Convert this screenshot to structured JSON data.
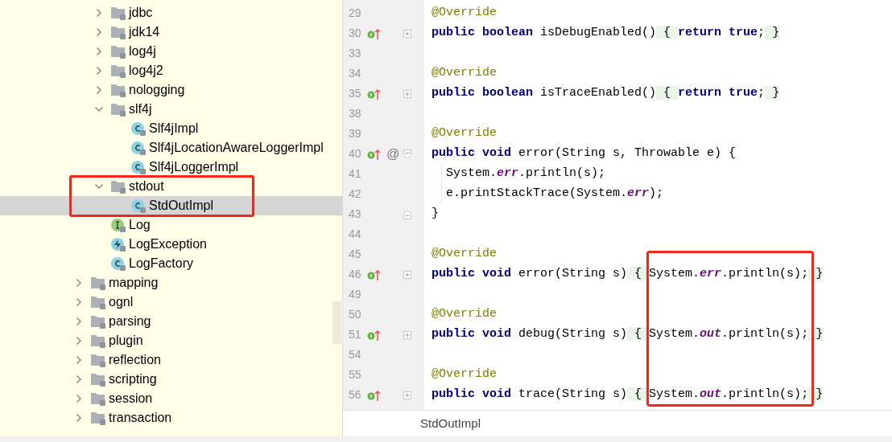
{
  "tree": [
    {
      "kind": "continued",
      "children": [
        {
          "label": "jdbc",
          "kind": "folder",
          "expanded": false,
          "selected": false
        },
        {
          "label": "jdk14",
          "kind": "folder",
          "expanded": false,
          "selected": false
        },
        {
          "label": "log4j",
          "kind": "folder",
          "expanded": false,
          "selected": false
        },
        {
          "label": "log4j2",
          "kind": "folder",
          "expanded": false,
          "selected": false
        },
        {
          "label": "nologging",
          "kind": "folder",
          "expanded": false,
          "selected": false
        },
        {
          "label": "slf4j",
          "kind": "folder",
          "expanded": true,
          "selected": false,
          "children": [
            {
              "label": "Slf4jImpl",
              "kind": "class",
              "selected": false
            },
            {
              "label": "Slf4jLocationAwareLoggerImpl",
              "kind": "class",
              "selected": false
            },
            {
              "label": "Slf4jLoggerImpl",
              "kind": "class",
              "selected": false
            }
          ]
        },
        {
          "label": "stdout",
          "kind": "folder",
          "expanded": true,
          "selected": false,
          "children": [
            {
              "label": "StdOutImpl",
              "kind": "class",
              "selected": true
            }
          ]
        },
        {
          "label": "Log",
          "kind": "interface",
          "selected": false
        },
        {
          "label": "LogException",
          "kind": "exception",
          "selected": false
        },
        {
          "label": "LogFactory",
          "kind": "class",
          "selected": false
        }
      ]
    },
    {
      "label": "mapping",
      "kind": "folder",
      "expanded": false,
      "selected": false
    },
    {
      "label": "ognl",
      "kind": "folder",
      "expanded": false,
      "selected": false
    },
    {
      "label": "parsing",
      "kind": "folder",
      "expanded": false,
      "selected": false
    },
    {
      "label": "plugin",
      "kind": "folder",
      "expanded": false,
      "selected": false
    },
    {
      "label": "reflection",
      "kind": "folder",
      "expanded": false,
      "selected": false
    },
    {
      "label": "scripting",
      "kind": "folder",
      "expanded": false,
      "selected": false
    },
    {
      "label": "session",
      "kind": "folder",
      "expanded": false,
      "selected": false
    },
    {
      "label": "transaction",
      "kind": "folder",
      "expanded": false,
      "selected": false
    }
  ],
  "code": [
    {
      "number": "29",
      "kind": "plain",
      "tokens": [
        {
          "kind": "ann",
          "text": "@Override"
        }
      ]
    },
    {
      "number": "30",
      "overrides": true,
      "kind": "collapsed",
      "tokens": [
        {
          "kind": "kw",
          "text": "public "
        },
        {
          "kind": "kw",
          "text": "boolean "
        },
        {
          "kind": "plain",
          "text": "isDebugEnabled()"
        },
        {
          "kind": "fold",
          "text": " { "
        },
        {
          "kind": "kw",
          "text": "return "
        },
        {
          "kind": "kw",
          "text": "true"
        },
        {
          "kind": "plain",
          "text": ";"
        },
        {
          "kind": "fold",
          "text": " }"
        }
      ]
    },
    {
      "number": "33",
      "kind": "plain"
    },
    {
      "number": "34",
      "kind": "plain",
      "tokens": [
        {
          "kind": "ann",
          "text": "@Override"
        }
      ]
    },
    {
      "number": "35",
      "overrides": true,
      "kind": "collapsed",
      "tokens": [
        {
          "kind": "kw",
          "text": "public "
        },
        {
          "kind": "kw",
          "text": "boolean "
        },
        {
          "kind": "plain",
          "text": "isTraceEnabled()"
        },
        {
          "kind": "fold",
          "text": " { "
        },
        {
          "kind": "kw",
          "text": "return "
        },
        {
          "kind": "kw",
          "text": "true"
        },
        {
          "kind": "plain",
          "text": ";"
        },
        {
          "kind": "fold",
          "text": " }"
        }
      ]
    },
    {
      "number": "38",
      "kind": "plain"
    },
    {
      "number": "39",
      "kind": "plain",
      "tokens": [
        {
          "kind": "ann",
          "text": "@Override"
        }
      ]
    },
    {
      "number": "40",
      "overrides": true,
      "marker": "@",
      "kind": "fold_start",
      "tokens": [
        {
          "kind": "kw",
          "text": "public "
        },
        {
          "kind": "kw",
          "text": "void "
        },
        {
          "kind": "plain",
          "text": "error(String s, Throwable e) {"
        }
      ]
    },
    {
      "number": "41",
      "kind": "plain",
      "indented": true,
      "tokens": [
        {
          "kind": "plain",
          "text": "System."
        },
        {
          "kind": "field",
          "text": "err"
        },
        {
          "kind": "plain",
          "text": ".println(s);"
        }
      ]
    },
    {
      "number": "42",
      "kind": "plain",
      "indented": true,
      "tokens": [
        {
          "kind": "plain",
          "text": "e.printStackTrace(System."
        },
        {
          "kind": "field",
          "text": "err"
        },
        {
          "kind": "plain",
          "text": ");"
        }
      ]
    },
    {
      "number": "43",
      "kind": "fold_end",
      "tokens": [
        {
          "kind": "plain",
          "text": "}"
        }
      ]
    },
    {
      "number": "44",
      "kind": "plain"
    },
    {
      "number": "45",
      "kind": "plain",
      "tokens": [
        {
          "kind": "ann",
          "text": "@Override"
        }
      ]
    },
    {
      "number": "46",
      "overrides": true,
      "kind": "collapsed",
      "tokens": [
        {
          "kind": "kw",
          "text": "public "
        },
        {
          "kind": "kw",
          "text": "void "
        },
        {
          "kind": "plain",
          "text": "error(String s)"
        },
        {
          "kind": "fold",
          "text": " { "
        },
        {
          "kind": "plain",
          "text": "System."
        },
        {
          "kind": "field",
          "text": "err"
        },
        {
          "kind": "plain",
          "text": ".println(s);"
        },
        {
          "kind": "fold",
          "text": " }"
        }
      ]
    },
    {
      "number": "49",
      "kind": "plain"
    },
    {
      "number": "50",
      "kind": "plain",
      "tokens": [
        {
          "kind": "ann",
          "text": "@Override"
        }
      ]
    },
    {
      "number": "51",
      "overrides": true,
      "kind": "collapsed",
      "tokens": [
        {
          "kind": "kw",
          "text": "public "
        },
        {
          "kind": "kw",
          "text": "void "
        },
        {
          "kind": "plain",
          "text": "debug(String s)"
        },
        {
          "kind": "fold",
          "text": " { "
        },
        {
          "kind": "plain",
          "text": "System."
        },
        {
          "kind": "field",
          "text": "out"
        },
        {
          "kind": "plain",
          "text": ".println(s);"
        },
        {
          "kind": "fold",
          "text": " }"
        }
      ]
    },
    {
      "number": "54",
      "kind": "plain"
    },
    {
      "number": "55",
      "kind": "plain",
      "tokens": [
        {
          "kind": "ann",
          "text": "@Override"
        }
      ]
    },
    {
      "number": "56",
      "overrides": true,
      "kind": "collapsed",
      "tokens": [
        {
          "kind": "kw",
          "text": "public "
        },
        {
          "kind": "kw",
          "text": "void "
        },
        {
          "kind": "plain",
          "text": "trace(String s)"
        },
        {
          "kind": "fold",
          "text": " { "
        },
        {
          "kind": "plain",
          "text": "System."
        },
        {
          "kind": "field",
          "text": "out"
        },
        {
          "kind": "plain",
          "text": ".println(s);"
        },
        {
          "kind": "fold",
          "text": " }"
        }
      ]
    }
  ],
  "breadcrumb": "StdOutImpl"
}
